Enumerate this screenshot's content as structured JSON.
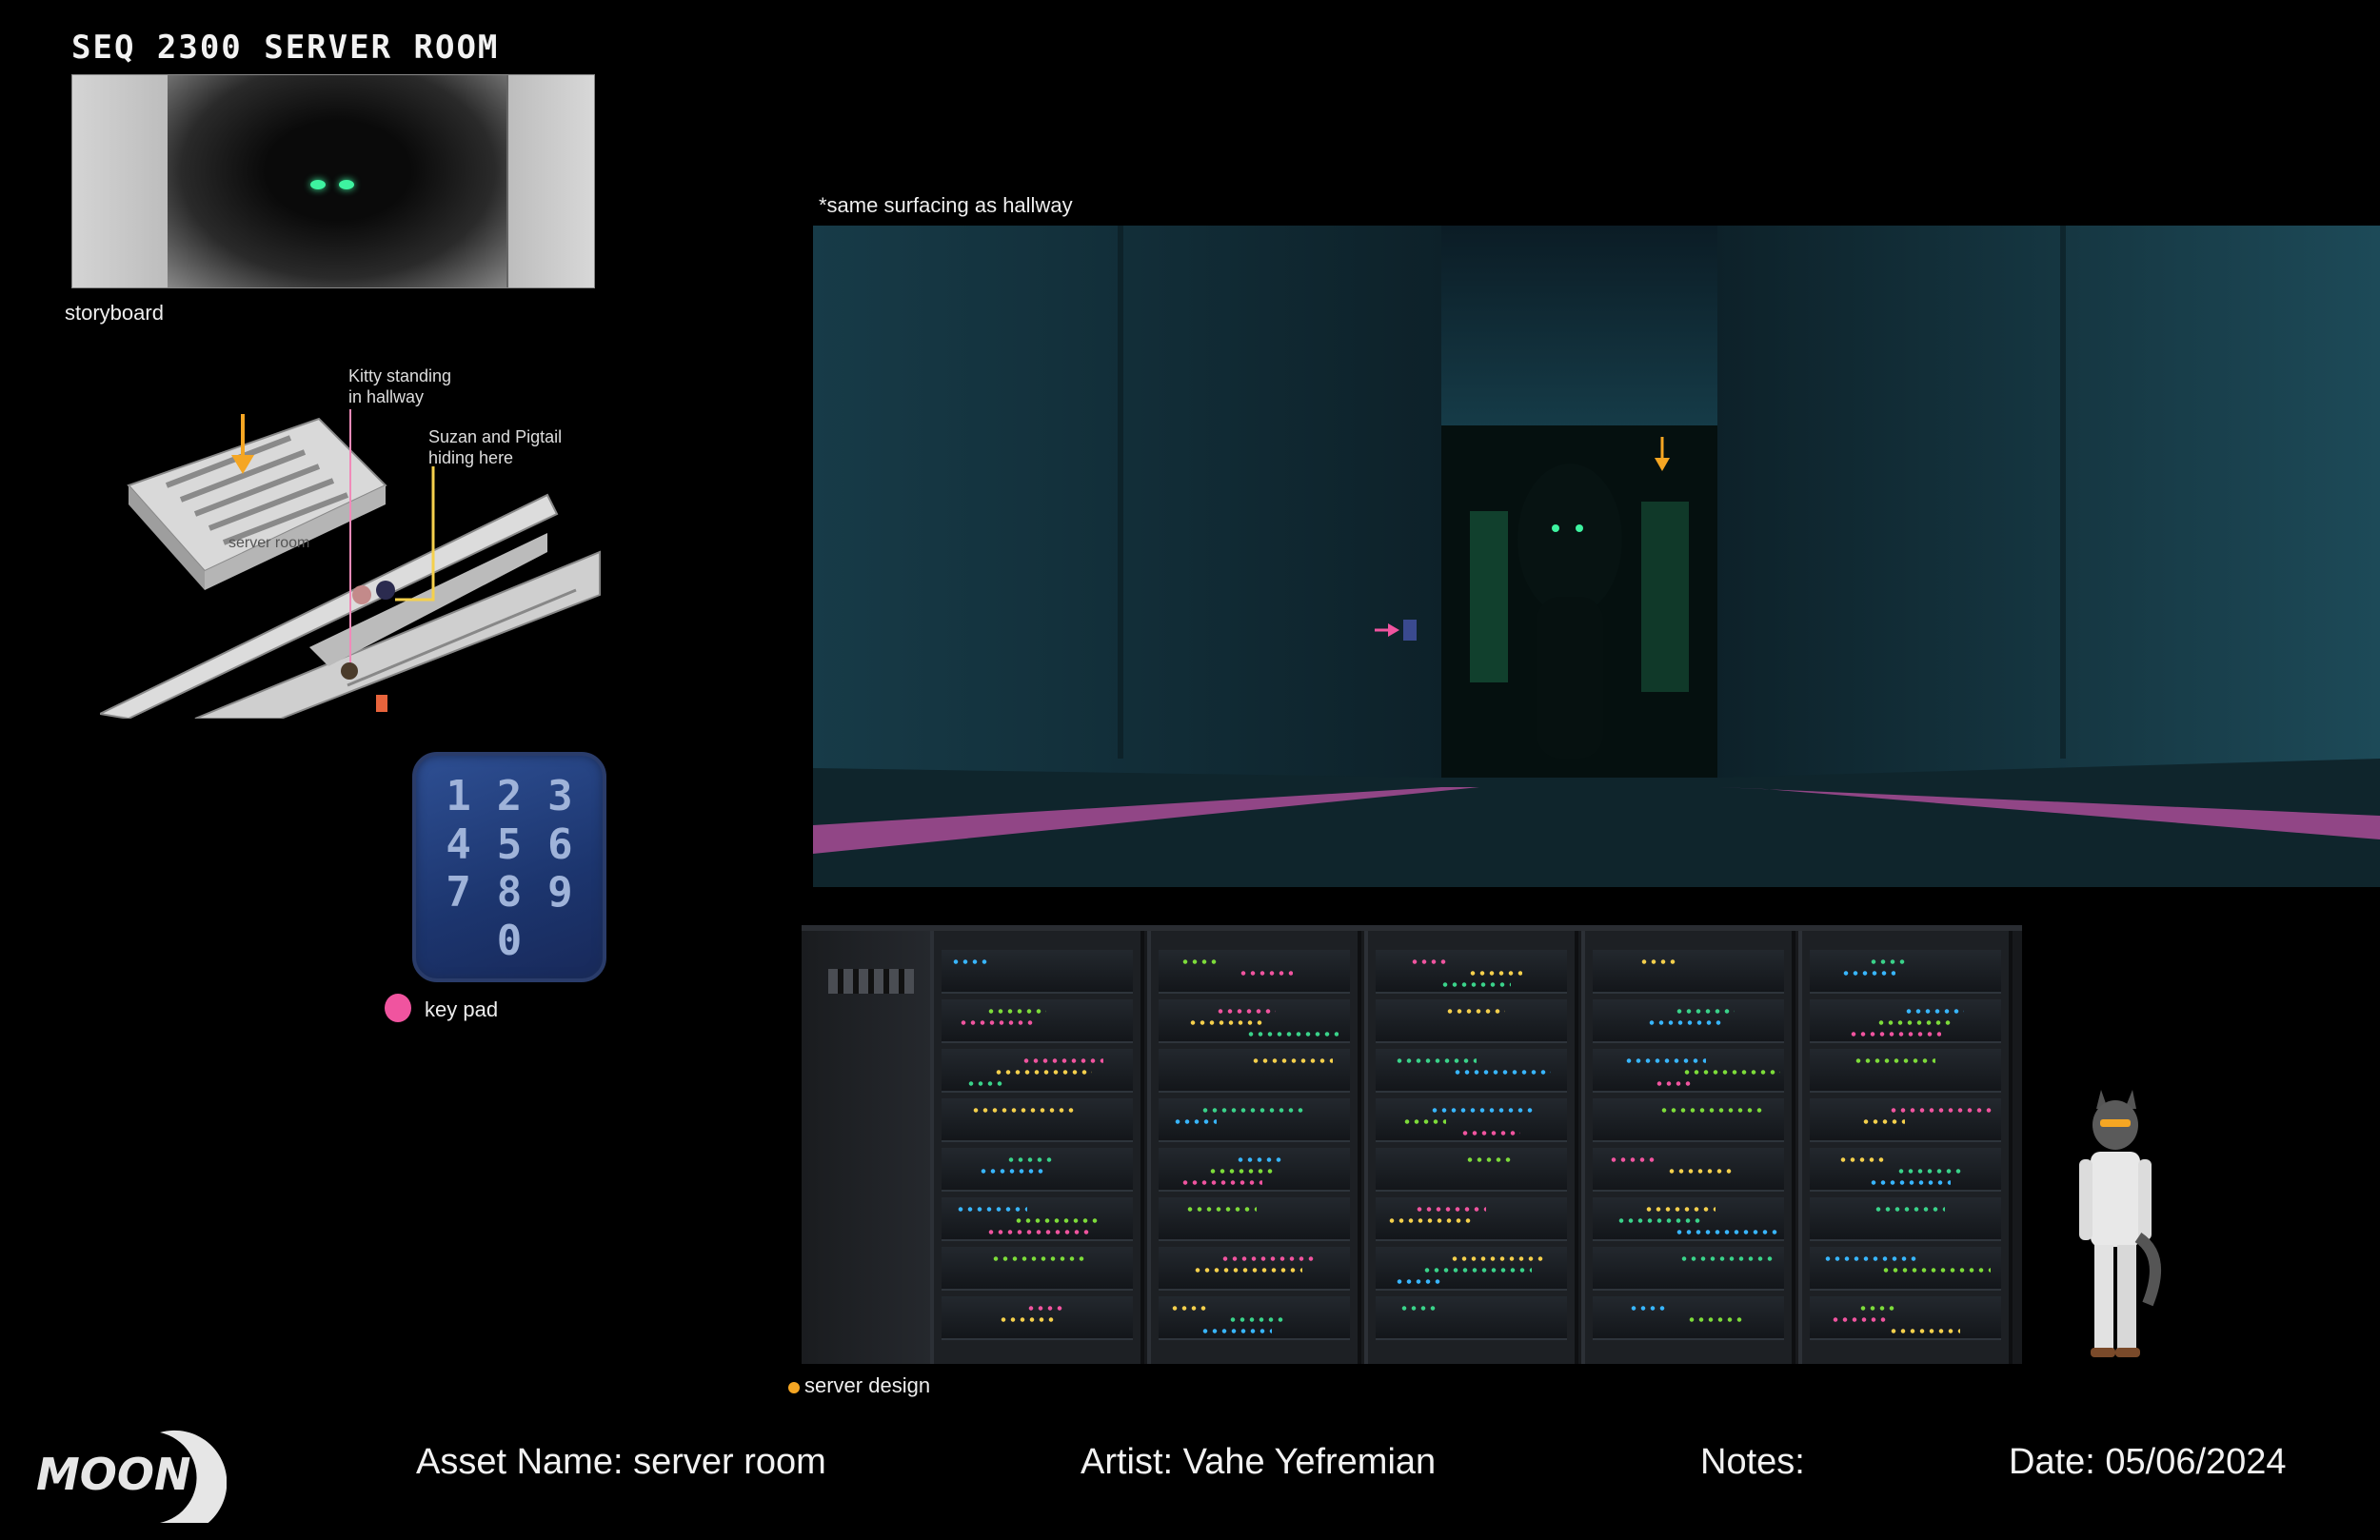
{
  "page": {
    "title": "SEQ 2300 SERVER ROOM"
  },
  "storyboard": {
    "label": "storyboard"
  },
  "map": {
    "callout_kitty": [
      "Kitty standing",
      "in hallway"
    ],
    "callout_suzan": [
      "Suzan and Pigtail",
      "hiding here"
    ],
    "room_label": "server room"
  },
  "keypad": {
    "keys": [
      "1",
      "2",
      "3",
      "4",
      "5",
      "6",
      "7",
      "8",
      "9",
      "0"
    ],
    "label": "key pad",
    "marker_color": "#f0549f"
  },
  "concept": {
    "note": "*same surfacing as hallway"
  },
  "server": {
    "label": "server design",
    "marker_color": "#f5a623"
  },
  "footer": {
    "logo_text": "MOON",
    "asset_name": "Asset Name: server room",
    "artist": "Artist: Vahe Yefremian",
    "notes": "Notes:",
    "date": "Date: 05/06/2024"
  }
}
